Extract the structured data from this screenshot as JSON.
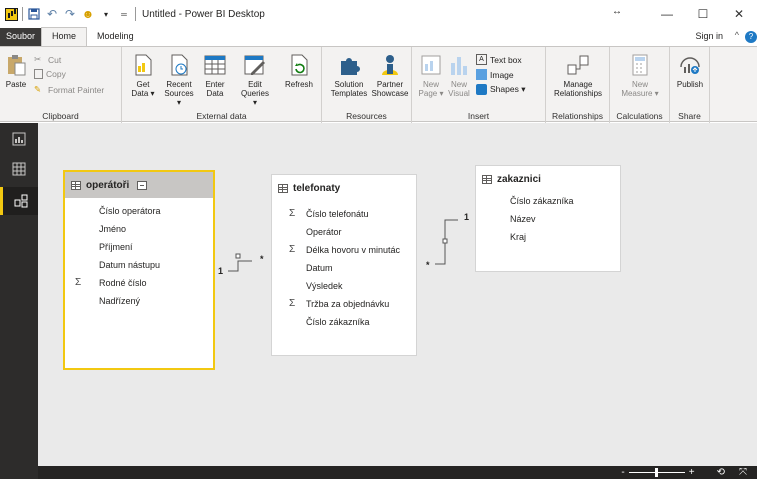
{
  "window": {
    "title": "Untitled - Power BI Desktop"
  },
  "tabs": [
    {
      "label": "Soubor"
    },
    {
      "label": "Home"
    },
    {
      "label": "Modeling"
    }
  ],
  "account": {
    "signin": "Sign in"
  },
  "ribbon": {
    "clipboard": {
      "label": "Clipboard",
      "paste": "Paste",
      "cut": "Cut",
      "copy": "Copy",
      "format_painter": "Format Painter"
    },
    "external_data": {
      "label": "External data",
      "get_data": [
        "Get",
        "Data ▾"
      ],
      "recent_sources": [
        "Recent",
        "Sources ▾"
      ],
      "enter_data": [
        "Enter",
        "Data"
      ],
      "edit_queries": [
        "Edit",
        "Queries ▾"
      ],
      "refresh": "Refresh"
    },
    "resources": {
      "label": "Resources",
      "solution_templates": [
        "Solution",
        "Templates"
      ],
      "partner_showcase": [
        "Partner",
        "Showcase"
      ]
    },
    "insert": {
      "label": "Insert",
      "new_page": [
        "New",
        "Page ▾"
      ],
      "new_visual": [
        "New",
        "Visual"
      ],
      "text_box": "Text box",
      "image": "Image",
      "shapes": "Shapes ▾"
    },
    "relationships": {
      "label": "Relationships",
      "manage": [
        "Manage",
        "Relationships"
      ]
    },
    "calculations": {
      "label": "Calculations",
      "new_measure": [
        "New",
        "Measure ▾"
      ]
    },
    "share": {
      "label": "Share",
      "publish": "Publish"
    }
  },
  "model": {
    "tables": [
      {
        "name": "operátoři",
        "fields": [
          {
            "label": "Číslo operátora",
            "sigma": false
          },
          {
            "label": "Jméno",
            "sigma": false
          },
          {
            "label": "Příjmení",
            "sigma": false
          },
          {
            "label": "Datum nástupu",
            "sigma": false
          },
          {
            "label": "Rodné číslo",
            "sigma": true
          },
          {
            "label": "Nadřízený",
            "sigma": false
          }
        ]
      },
      {
        "name": "telefonaty",
        "fields": [
          {
            "label": "Číslo telefonátu",
            "sigma": true
          },
          {
            "label": "Operátor",
            "sigma": false
          },
          {
            "label": "Délka hovoru v minutác",
            "sigma": true
          },
          {
            "label": "Datum",
            "sigma": false
          },
          {
            "label": "Výsledek",
            "sigma": false
          },
          {
            "label": "Tržba za objednávku",
            "sigma": true
          },
          {
            "label": "Číslo zákazníka",
            "sigma": false
          }
        ]
      },
      {
        "name": "zakaznici",
        "fields": [
          {
            "label": "Číslo zákazníka",
            "sigma": false
          },
          {
            "label": "Název",
            "sigma": false
          },
          {
            "label": "Kraj",
            "sigma": false
          }
        ]
      }
    ],
    "relationships": [
      {
        "one": "1",
        "many": "*"
      },
      {
        "one": "1",
        "many": "*"
      }
    ]
  },
  "status": {
    "zoom_minus": "-",
    "zoom_plus": "+"
  },
  "colors": {
    "accent": "#f2c811",
    "nav": "#2d2c2b",
    "canvas": "#eaeaea"
  }
}
